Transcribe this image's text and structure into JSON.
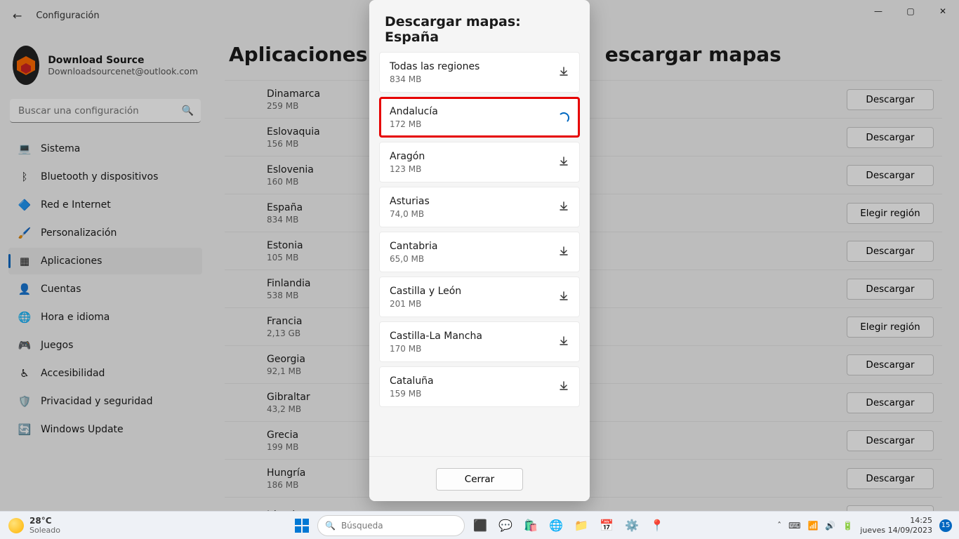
{
  "window_title": "Configuración",
  "profile": {
    "name": "Download Source",
    "email": "Downloadsourcenet@outlook.com"
  },
  "search_placeholder": "Buscar una configuración",
  "sidebar": {
    "items": [
      {
        "label": "Sistema",
        "icon": "💻"
      },
      {
        "label": "Bluetooth y dispositivos",
        "icon": "ᛒ"
      },
      {
        "label": "Red e Internet",
        "icon": "🔷"
      },
      {
        "label": "Personalización",
        "icon": "🖌️"
      },
      {
        "label": "Aplicaciones",
        "icon": "▦"
      },
      {
        "label": "Cuentas",
        "icon": "👤"
      },
      {
        "label": "Hora e idioma",
        "icon": "🌐"
      },
      {
        "label": "Juegos",
        "icon": "🎮"
      },
      {
        "label": "Accesibilidad",
        "icon": "♿"
      },
      {
        "label": "Privacidad y seguridad",
        "icon": "🛡️"
      },
      {
        "label": "Windows Update",
        "icon": "🔄"
      }
    ]
  },
  "breadcrumb": {
    "root": "Aplicaciones",
    "leaf": "escargar mapas"
  },
  "download_label": "Descargar",
  "region_label": "Elegir región",
  "countries": [
    {
      "name": "Dinamarca",
      "size": "259 MB",
      "action": "download"
    },
    {
      "name": "Eslovaquia",
      "size": "156 MB",
      "action": "download"
    },
    {
      "name": "Eslovenia",
      "size": "160 MB",
      "action": "download"
    },
    {
      "name": "España",
      "size": "834 MB",
      "action": "region"
    },
    {
      "name": "Estonia",
      "size": "105 MB",
      "action": "download"
    },
    {
      "name": "Finlandia",
      "size": "538 MB",
      "action": "download"
    },
    {
      "name": "Francia",
      "size": "2,13 GB",
      "action": "region"
    },
    {
      "name": "Georgia",
      "size": "92,1 MB",
      "action": "download"
    },
    {
      "name": "Gibraltar",
      "size": "43,2 MB",
      "action": "download"
    },
    {
      "name": "Grecia",
      "size": "199 MB",
      "action": "download"
    },
    {
      "name": "Hungría",
      "size": "186 MB",
      "action": "download"
    },
    {
      "name": "Irlanda",
      "size": "",
      "action": "download"
    }
  ],
  "dialog": {
    "title": "Descargar mapas: España",
    "regions": [
      {
        "name": "Todas las regiones",
        "size": "834 MB",
        "state": "idle"
      },
      {
        "name": "Andalucía",
        "size": "172 MB",
        "state": "loading",
        "highlight": true
      },
      {
        "name": "Aragón",
        "size": "123 MB",
        "state": "idle"
      },
      {
        "name": "Asturias",
        "size": "74,0 MB",
        "state": "idle"
      },
      {
        "name": "Cantabria",
        "size": "65,0 MB",
        "state": "idle"
      },
      {
        "name": "Castilla y León",
        "size": "201 MB",
        "state": "idle"
      },
      {
        "name": "Castilla-La Mancha",
        "size": "170 MB",
        "state": "idle"
      },
      {
        "name": "Cataluña",
        "size": "159 MB",
        "state": "idle"
      }
    ],
    "close_label": "Cerrar"
  },
  "taskbar": {
    "temp": "28°C",
    "cond": "Soleado",
    "search_placeholder": "Búsqueda",
    "time": "14:25",
    "date": "jueves 14/09/2023",
    "notif_count": "15"
  }
}
